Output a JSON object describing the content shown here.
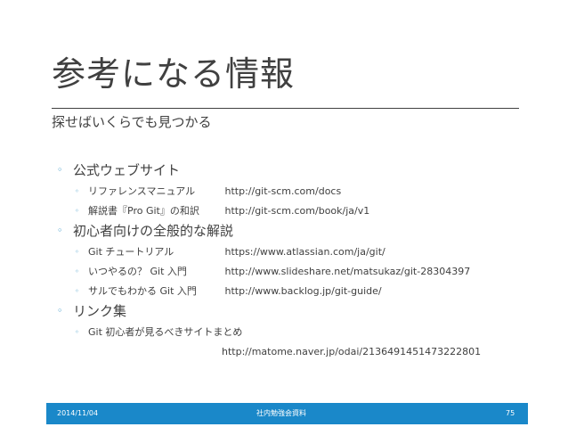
{
  "slide": {
    "title": "参考になる情報",
    "subtitle": "探せばいくらでも見つかる",
    "bullet_glyph": "◦",
    "accent_color": "#1a88c9",
    "sections": [
      {
        "heading": "公式ウェブサイト",
        "items": [
          {
            "label": "リファレンスマニュアル",
            "url": "http://git-scm.com/docs"
          },
          {
            "label": "解説書『Pro Git』の和訳",
            "url": "http://git-scm.com/book/ja/v1"
          }
        ]
      },
      {
        "heading": "初心者向けの全般的な解説",
        "items": [
          {
            "label": "Git チュートリアル",
            "url": "https://www.atlassian.com/ja/git/"
          },
          {
            "label": "いつやるの？ Git 入門",
            "url": "http://www.slideshare.net/matsukaz/git-28304397"
          },
          {
            "label": "サルでもわかる Git 入門",
            "url": "http://www.backlog.jp/git-guide/"
          }
        ]
      },
      {
        "heading": "リンク集",
        "items": [
          {
            "label": "Git 初心者が見るべきサイトまとめ",
            "url": "http://matome.naver.jp/odai/2136491451473222801"
          }
        ]
      }
    ]
  },
  "footer": {
    "date": "2014/11/04",
    "center": "社内勉強会資料",
    "page": "75"
  }
}
